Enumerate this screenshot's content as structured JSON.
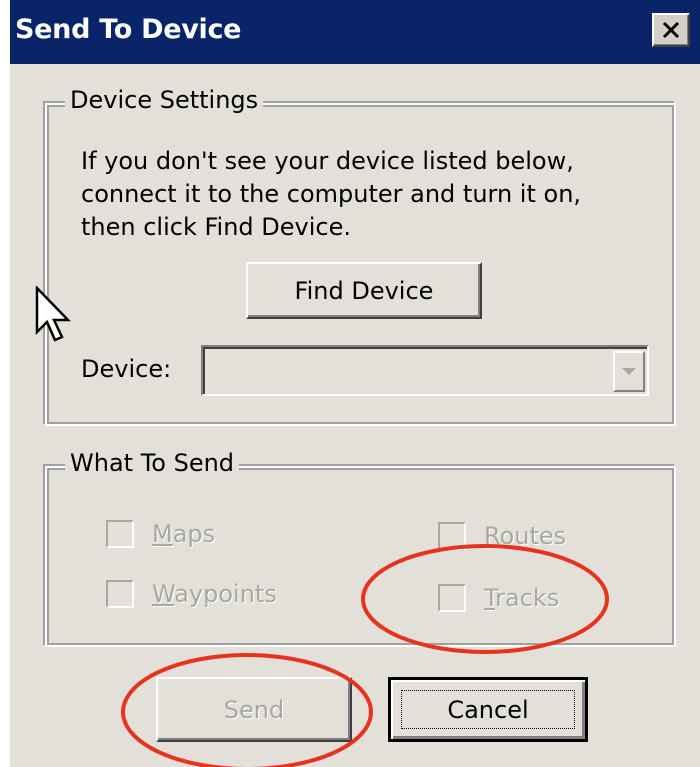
{
  "dialog": {
    "title": "Send To Device",
    "close_label": "Close"
  },
  "device_settings": {
    "group_label": "Device Settings",
    "info_text": "If you don't see your device listed below, connect it to the computer and turn it on, then click Find Device.",
    "find_button_label": "Find Device",
    "device_label": "Device:",
    "device_value": ""
  },
  "what_to_send": {
    "group_label": "What To Send",
    "items": [
      {
        "label": "Maps",
        "mnemonic": "M",
        "rest": "aps",
        "checked": false,
        "enabled": false
      },
      {
        "label": "Waypoints",
        "mnemonic": "W",
        "rest": "aypoints",
        "checked": false,
        "enabled": false
      },
      {
        "label": "Routes",
        "mnemonic": "R",
        "rest": "outes",
        "checked": false,
        "enabled": false
      },
      {
        "label": "Tracks",
        "mnemonic": "T",
        "rest": "racks",
        "checked": false,
        "enabled": false
      }
    ]
  },
  "buttons": {
    "send_label": "Send",
    "cancel_label": "Cancel"
  },
  "colors": {
    "titlebar": "#0a246a",
    "dialog_bg": "#e2e0d8",
    "annotation": "#e8321e",
    "disabled_text": "#a8a8a0"
  }
}
